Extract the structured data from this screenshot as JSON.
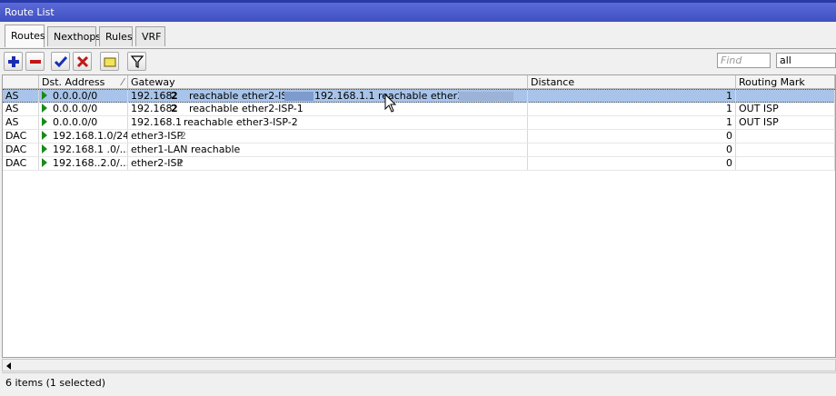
{
  "window": {
    "title": "Route List"
  },
  "tabs": [
    {
      "label": "Routes",
      "active": true
    },
    {
      "label": "Nexthops",
      "active": false
    },
    {
      "label": "Rules",
      "active": false
    },
    {
      "label": "VRF",
      "active": false
    }
  ],
  "toolbar": {
    "buttons": [
      "add-icon",
      "remove-icon",
      "enable-icon",
      "disable-icon",
      "comment-icon",
      "filter-icon"
    ],
    "find_placeholder": "Find",
    "filter_select": "all"
  },
  "columns": {
    "flags": "",
    "dst": "Dst. Address",
    "gateway": "Gateway",
    "distance": "Distance",
    "routing_mark": "Routing Mark"
  },
  "rows": [
    {
      "flags": "AS",
      "dst": "0.0.0.0/0",
      "gw1": "192.168.",
      "gw1b": "2",
      "gw2": "reachable ether2-ISP",
      "gw3": "192.168.1.1 reachable ether3-ISP",
      "distance": "1",
      "mark": "",
      "selected": true
    },
    {
      "flags": "AS",
      "dst": "0.0.0.0/0",
      "gw1": "192.168.",
      "gw1b": "2",
      "gw2": "reachable ether2-ISP-1",
      "gw3": "",
      "distance": "1",
      "mark": "OUT ISP",
      "selected": false
    },
    {
      "flags": "AS",
      "dst": "0.0.0.0/0",
      "gw1": "192.168.1",
      "gw1b": "",
      "gw2": "reachable ether3-ISP-2",
      "gw3": "",
      "distance": "1",
      "mark": "OUT ISP",
      "selected": false
    },
    {
      "flags": "DAC",
      "dst": "192.168.1.0/24",
      "gw1": "ether3-ISP",
      "gw1b": "2",
      "gw2": "",
      "gw3": "",
      "distance": "0",
      "mark": "",
      "selected": false
    },
    {
      "flags": "DAC",
      "dst": "192.168.1 .0/...",
      "gw1": "ether1-LAN reachable",
      "gw1b": "",
      "gw2": "",
      "gw3": "",
      "distance": "0",
      "mark": "",
      "selected": false
    },
    {
      "flags": "DAC",
      "dst": "192.168..2.0/...",
      "gw1": "ether2-ISP",
      "gw1b": "1",
      "gw2": "",
      "gw3": "",
      "distance": "0",
      "mark": "",
      "selected": false
    }
  ],
  "status": {
    "text": "6 items (1 selected)"
  }
}
